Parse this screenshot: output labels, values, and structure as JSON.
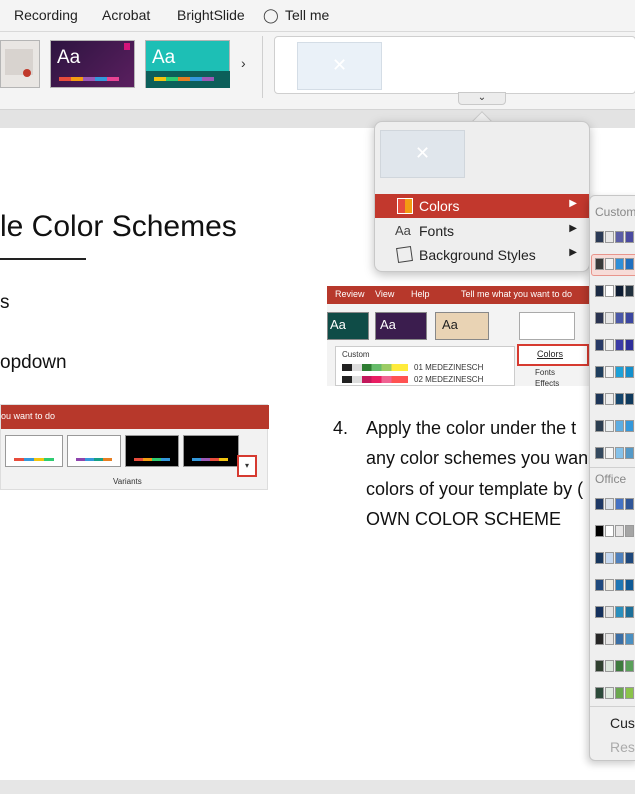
{
  "menubar": {
    "items": [
      "Recording",
      "Acrobat",
      "BrightSlide",
      "Tell me"
    ]
  },
  "ribbon": {
    "more_arrow": "›",
    "expand_arrow": "⌄",
    "theme_label": "Aa"
  },
  "slide": {
    "title": "le Color Schemes",
    "bullet_1": "s",
    "bullet_2": "opdown",
    "step_number": "4.",
    "step_lines": [
      "Apply the color under the t",
      "any color schemes you wan",
      "colors of your template by (",
      "OWN COLOR SCHEME"
    ]
  },
  "screenshot_left": {
    "bar_text": "ou want to do",
    "variants_label": "Variants",
    "dropdown_glyph": "▾"
  },
  "screenshot_right": {
    "tabs": [
      "Review",
      "View",
      "Help",
      "Tell me what you want to do"
    ],
    "theme_labels": [
      "Aa",
      "Aa",
      "Aa"
    ],
    "custom_label": "Custom",
    "rows": [
      "01 MEDEZINESCH",
      "02 MEDEZINESCH"
    ],
    "colors_label": "Colors",
    "fonts_label": "Fonts",
    "effects_label": "Effects"
  },
  "popover": {
    "items": [
      {
        "label": "Colors",
        "icon": "palette-icon"
      },
      {
        "label": "Fonts",
        "icon": "Aa"
      },
      {
        "label": "Background Styles",
        "icon": "background-icon"
      }
    ],
    "submenu_arrow": "▶"
  },
  "submenu": {
    "custom_header": "Custom",
    "office_header": "Office",
    "customize_label": "Cust",
    "reset_label": "Rese"
  },
  "colors": {
    "accent_red": "#c2382d",
    "theme_purple": "#3b1d4e",
    "theme_teal": "#1dbfb5"
  }
}
